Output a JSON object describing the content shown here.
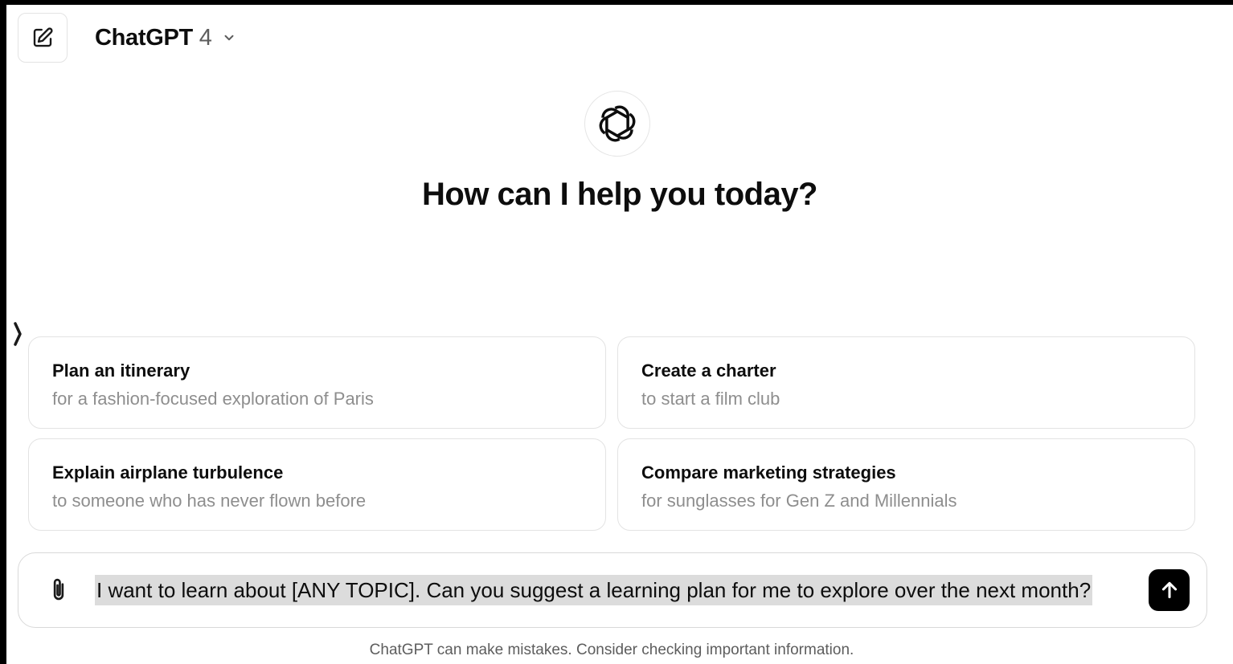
{
  "header": {
    "model_name": "ChatGPT",
    "model_version": "4",
    "new_chat_icon": "pencil-square-icon",
    "dropdown_icon": "chevron-down-icon"
  },
  "main": {
    "logo_icon": "openai-logo-icon",
    "headline": "How can I help you today?"
  },
  "sidebar": {
    "toggle_icon": "chevron-right-icon"
  },
  "suggestions": [
    {
      "title": "Plan an itinerary",
      "subtitle": "for a fashion-focused exploration of Paris"
    },
    {
      "title": "Create a charter",
      "subtitle": "to start a film club"
    },
    {
      "title": "Explain airplane turbulence",
      "subtitle": "to someone who has never flown before"
    },
    {
      "title": "Compare marketing strategies",
      "subtitle": "for sunglasses for Gen Z and Millennials"
    }
  ],
  "composer": {
    "value": "I want to learn about [ANY TOPIC]. Can you suggest a learning plan for me to explore over the next month?",
    "attach_icon": "paperclip-icon",
    "send_icon": "arrow-up-icon"
  },
  "footer": {
    "disclaimer": "ChatGPT can make mistakes. Consider checking important information."
  },
  "colors": {
    "text_primary": "#0d0d0d",
    "text_secondary": "#8e8e8e",
    "border": "#e3e3e3",
    "send_button": "#000000",
    "selection_highlight": "#dcdcdc"
  }
}
